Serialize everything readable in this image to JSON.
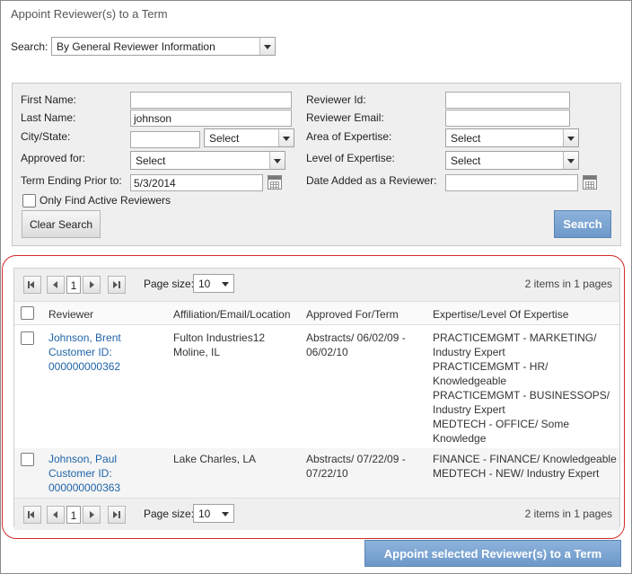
{
  "title": "Appoint Reviewer(s) to a Term",
  "search": {
    "label": "Search:",
    "value": "By General Reviewer Information"
  },
  "form": {
    "first_name_label": "First Name:",
    "last_name_label": "Last Name:",
    "last_name_value": "johnson",
    "city_state_label": "City/State:",
    "state_value": "Select",
    "approved_for_label": "Approved for:",
    "approved_for_value": "Select",
    "term_ending_label": "Term Ending Prior to:",
    "term_ending_value": "5/3/2014",
    "only_active_label": "Only Find Active Reviewers",
    "reviewer_id_label": "Reviewer Id:",
    "reviewer_email_label": "Reviewer Email:",
    "area_label": "Area of Expertise:",
    "area_value": "Select",
    "level_label": "Level of Expertise:",
    "level_value": "Select",
    "date_added_label": "Date Added as a Reviewer:",
    "clear_label": "Clear Search",
    "search_label": "Search"
  },
  "pager": {
    "page": "1",
    "page_size_label": "Page size:",
    "page_size": "10",
    "summary": "2 items in 1 pages"
  },
  "columns": [
    "Reviewer",
    "Affiliation/Email/Location",
    "Approved For/Term",
    "Expertise/Level Of Expertise"
  ],
  "rows": [
    {
      "reviewer_name": "Johnson, Brent",
      "customer_id_label": "Customer ID:",
      "customer_id": "000000000362",
      "affiliation": [
        "Fulton Industries12",
        "Moline, IL"
      ],
      "approved": [
        "Abstracts/ 06/02/09 -",
        "06/02/10"
      ],
      "expertise": [
        "PRACTICEMGMT - MARKETING/",
        "Industry Expert",
        "PRACTICEMGMT - HR/",
        "Knowledgeable",
        "PRACTICEMGMT - BUSINESSOPS/",
        "Industry Expert",
        "MEDTECH - OFFICE/ Some",
        "Knowledge"
      ]
    },
    {
      "reviewer_name": "Johnson, Paul",
      "customer_id_label": "Customer ID:",
      "customer_id": "000000000363",
      "affiliation": [
        "Lake Charles, LA"
      ],
      "approved": [
        "Abstracts/ 07/22/09 -",
        "07/22/10"
      ],
      "expertise": [
        "FINANCE - FINANCE/ Knowledgeable",
        "MEDTECH - NEW/ Industry Expert"
      ]
    }
  ],
  "appoint_label": "Appoint selected Reviewer(s) to a Term",
  "colors": {
    "link": "#1f64a8",
    "highlight_border": "#d32a2a",
    "button_blue": "#6d98c9"
  }
}
